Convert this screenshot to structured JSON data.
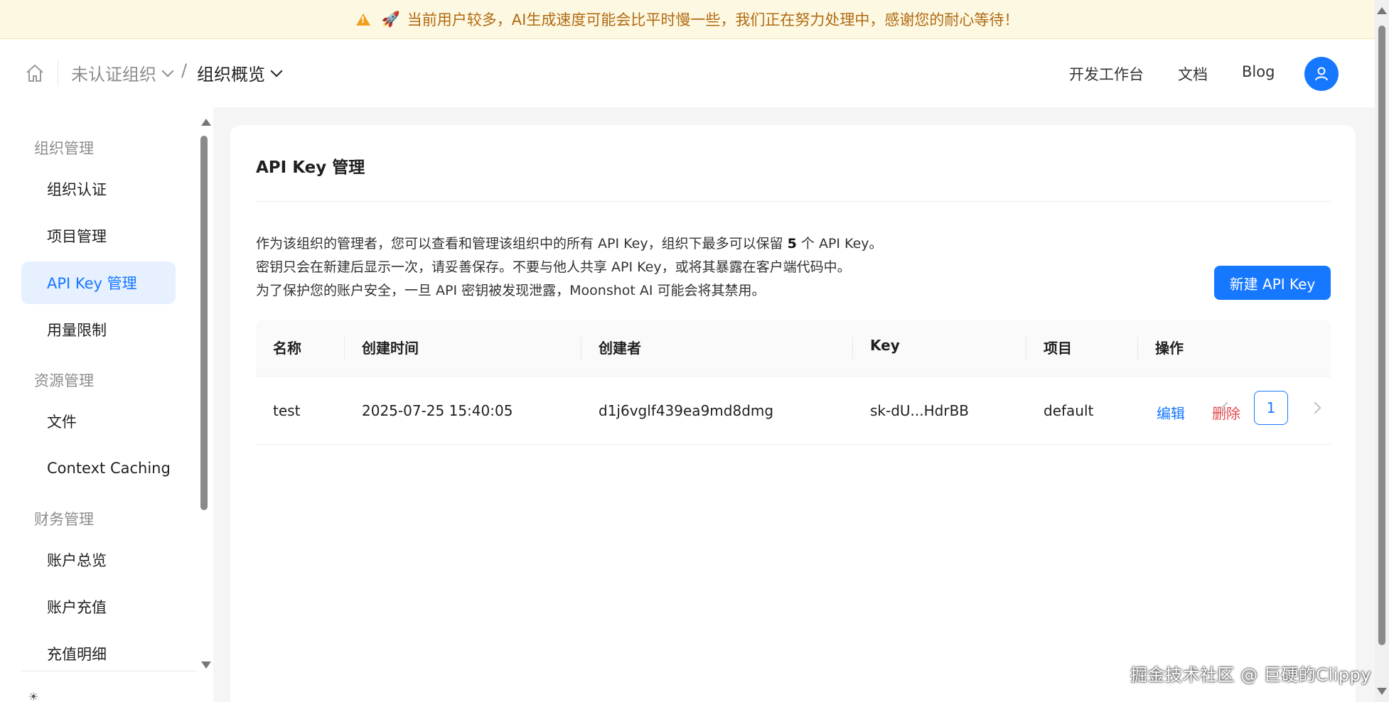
{
  "banner": {
    "icon": "warning-icon",
    "emoji": "🚀",
    "text": "当前用户较多，AI生成速度可能会比平时慢一些，我们正在努力处理中，感谢您的耐心等待！"
  },
  "header": {
    "org_label": "未认证组织",
    "separator": "/",
    "page_label": "组织概览",
    "nav": {
      "dev": "开发工作台",
      "docs": "文档",
      "blog": "Blog"
    }
  },
  "sidebar": {
    "sections": [
      {
        "title": "组织管理",
        "items": [
          "组织认证",
          "项目管理",
          "API Key 管理",
          "用量限制"
        ]
      },
      {
        "title": "资源管理",
        "items": [
          "文件",
          "Context Caching"
        ]
      },
      {
        "title": "财务管理",
        "items": [
          "账户总览",
          "账户充值",
          "充值明细"
        ]
      }
    ],
    "active_item": "API Key 管理"
  },
  "main": {
    "title": "API Key 管理",
    "desc_line1_pre": "作为该组织的管理者，您可以查看和管理该组织中的所有 API Key，组织下最多可以保留",
    "desc_line1_num": "5",
    "desc_line1_post": "个 API Key。",
    "desc_line2": "密钥只会在新建后显示一次，请妥善保存。不要与他人共享 API Key，或将其暴露在客户端代码中。",
    "desc_line3": "为了保护您的账户安全，一旦 API 密钥被发现泄露，Moonshot AI 可能会将其禁用。",
    "new_button": "新建 API Key",
    "table": {
      "columns": [
        "名称",
        "创建时间",
        "创建者",
        "Key",
        "项目",
        "操作"
      ],
      "rows": [
        {
          "name": "test",
          "created": "2025-07-25 15:40:05",
          "creator": "d1j6vglf439ea9md8dmg",
          "key": "sk-dU...HdrBB",
          "project": "default",
          "edit": "编辑",
          "delete": "删除"
        }
      ]
    },
    "pagination": {
      "current": "1"
    }
  },
  "watermark": "掘金技术社区 @ 巨硬的Clippy",
  "colors": {
    "accent": "#1677ff",
    "danger": "#e5484d",
    "banner_bg": "#fdf8e2",
    "banner_text": "#b06a12"
  }
}
